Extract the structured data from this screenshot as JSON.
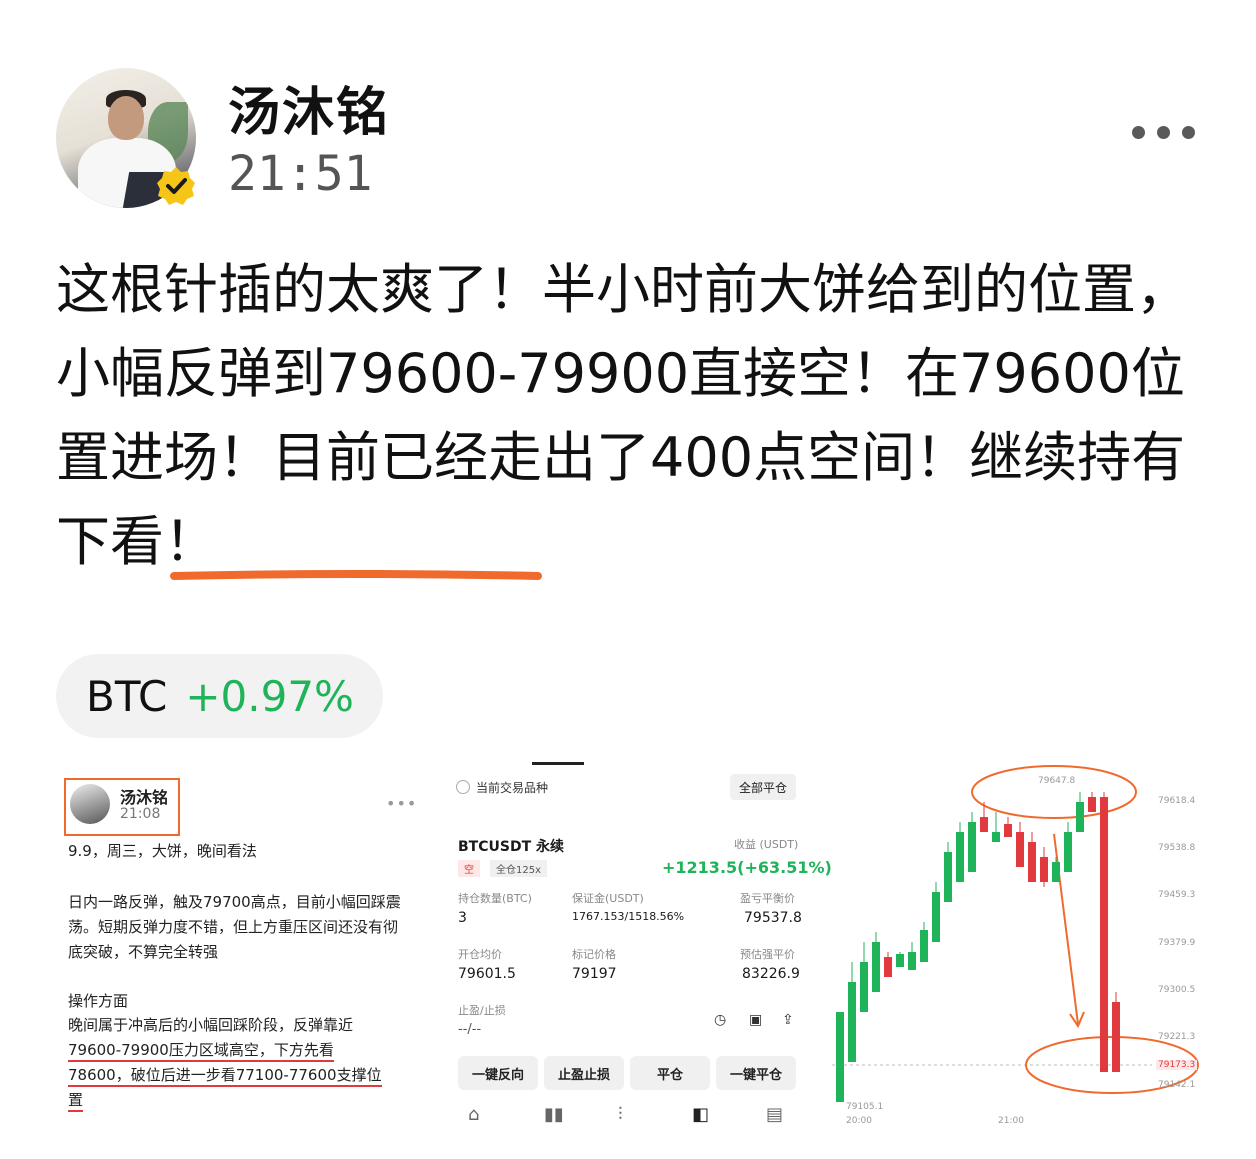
{
  "author": {
    "name": "汤沐铭",
    "time": "21:51",
    "verified": true
  },
  "post": {
    "text_before": "这根针插的太爽了！半小时前大饼给到的位置，小幅反弹到79600-79900直接空！在79600位置进场！目前已经走出了400点空间！",
    "text_highlight": "继续持有下看！"
  },
  "ticker": {
    "symbol": "BTC",
    "change": "+0.97%"
  },
  "colors": {
    "up": "#1fb35a",
    "down": "#e0393e",
    "accent": "#f06a2e"
  },
  "image1": {
    "name": "汤沐铭",
    "time": "21:08",
    "date_line": "9.9，周三，大饼，晚间看法",
    "para1": "日内一路反弹，触及79700高点，目前小幅回踩震荡。短期反弹力度不错，但上方重压区间还没有彻底突破，不算完全转强",
    "heading": "操作方面",
    "para2_a": "晚间属于冲高后的小幅回踩阶段，反弹靠近",
    "para2_b": "79600-79900压力区域高空，下方先看",
    "para2_c": "78600，破位后进一步看77100-77600支撑位",
    "para2_d": "置"
  },
  "image2": {
    "current_symbol_label": "当前交易品种",
    "close_all_label": "全部平仓",
    "contract": "BTCUSDT 永续",
    "side": "空",
    "margin_mode": "全仓125x",
    "pnl_label": "收益 (USDT)",
    "pnl_value": "+1213.5(+63.51%)",
    "fields": [
      {
        "label": "持仓数量(BTC)",
        "value": "3"
      },
      {
        "label": "保证金(USDT)",
        "value": "1767.153/1518.56%"
      },
      {
        "label": "盈亏平衡价",
        "value": "79537.8"
      },
      {
        "label": "开仓均价",
        "value": "79601.5"
      },
      {
        "label": "标记价格",
        "value": "79197"
      },
      {
        "label": "预估强平价",
        "value": "83226.9"
      }
    ],
    "tp_sl_label": "止盈/止损",
    "tp_sl_value": "--/--",
    "buttons": [
      "一键反向",
      "止盈止损",
      "平仓",
      "一键平仓"
    ]
  },
  "image3": {
    "chart_data": {
      "type": "candlestick",
      "y_ticks": [
        "79618.4",
        "79538.8",
        "79459.3",
        "79379.9",
        "79300.5",
        "79221.3",
        "79173.3",
        "79142.1"
      ],
      "x_ticks": [
        "20:00",
        "21:00"
      ],
      "high_label": "79647.8",
      "low_label": "79105.1",
      "current_price": "79173.3"
    }
  }
}
